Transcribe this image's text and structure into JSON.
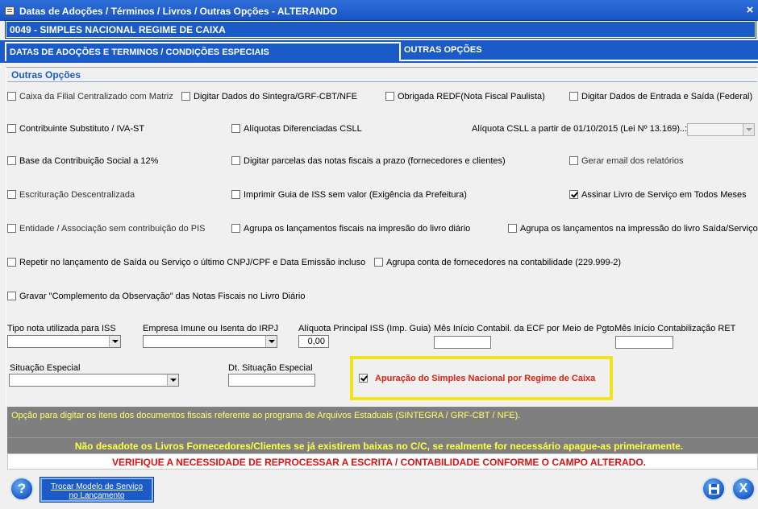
{
  "window": {
    "title": "Datas de Adoções / Términos / Livros / Outras Opções   -   ALTERANDO",
    "close": "×"
  },
  "company": "0049   -   SIMPLES NACIONAL REGIME DE CAIXA",
  "tabs": {
    "datas": "DATAS DE ADOÇÕES E TERMINOS / CONDIÇÕES ESPECIAIS",
    "outras": "OUTRAS OPÇÕES"
  },
  "section_title": "Outras Opções",
  "checkboxes": [
    {
      "label": "Caixa da Filial Centralizado com Matriz",
      "checked": false
    },
    {
      "label": "Digitar Dados do Sintegra/GRF-CBT/NFE",
      "checked": false
    },
    {
      "label": "Obrigada REDF(Nota Fiscal Paulista)",
      "checked": false
    },
    {
      "label": "Digitar Dados de Entrada e Saída (Federal)",
      "checked": false
    },
    {
      "label": "Contribuinte Substituto / IVA-ST",
      "checked": false
    },
    {
      "label": "Alíquotas Diferenciadas CSLL",
      "checked": false
    },
    {
      "label": "Base da Contribuição Social a 12%",
      "checked": false
    },
    {
      "label": "Digitar parcelas das notas fiscais a prazo (fornecedores e clientes)",
      "checked": false
    },
    {
      "label": "Gerar email dos relatórios",
      "checked": false
    },
    {
      "label": "Escrituração Descentralizada",
      "checked": false
    },
    {
      "label": "Imprimir Guia de ISS sem valor (Exigência da Prefeitura)",
      "checked": false
    },
    {
      "label": "Assinar Livro de Serviço em Todos Meses",
      "checked": true
    },
    {
      "label": "Entidade / Associação sem contribuição do PIS",
      "checked": false
    },
    {
      "label": "Agrupa os lançamentos fiscais na impresão do livro diário",
      "checked": false
    },
    {
      "label": "Agrupa os lançamentos na impressão do livro Saída/Serviço",
      "checked": false
    },
    {
      "label": "Repetir no lançamento de Saída ou Serviço o último CNPJ/CPF e Data Emissão incluso",
      "checked": false
    },
    {
      "label": "Agrupa conta de fornecedores na contabilidade (229.999-2)",
      "checked": false
    },
    {
      "label": "Gravar \"Complemento da Observação\" das Notas Fiscais no Livro Diário",
      "checked": false
    }
  ],
  "aliquota_csll": {
    "label": "Alíquota CSLL a partir de 01/10/2015 (Lei Nº 13.169)..:",
    "value": ""
  },
  "fields": {
    "tipo_nota_iss": {
      "label": "Tipo nota utilizada para ISS",
      "value": ""
    },
    "empresa_imune": {
      "label": "Empresa Imune ou Isenta do IRPJ",
      "value": ""
    },
    "aliquota_iss": {
      "label": "Alíquota Principal ISS (Imp. Guia)",
      "value": "0,00"
    },
    "mes_inicio_ecf": {
      "label": "Mês Início Contabil. da ECF por Meio de Pgto.",
      "value": ""
    },
    "mes_inicio_ret": {
      "label": "Mês Início Contabilização RET",
      "value": ""
    },
    "situacao_especial": {
      "label": "Situação Especial",
      "value": ""
    },
    "dt_situacao_especial": {
      "label": "Dt. Situação Especial",
      "value": ""
    }
  },
  "apuracao": {
    "label": "Apuração do Simples Nacional por Regime de Caixa",
    "checked": true
  },
  "info": {
    "line1": "Opção para digitar os itens dos documentos fiscais referente ao programa de Arquivos Estaduais (SINTEGRA / GRF-CBT / NFE).",
    "line2": "Não desadote os Livros Fornecedores/Clientes se já existirem baixas no C/C, se realmente for necessário apague-as primeiramente.",
    "line3": "VERIFIQUE A NECESSIDADE DE REPROCESSAR A ESCRITA / CONTABILIDADE CONFORME O CAMPO ALTERADO."
  },
  "buttons": {
    "help": "?",
    "trocar_line1": "Trocar Modelo de Serviço",
    "trocar_line2": "no Lançamento",
    "exit": "X"
  },
  "colors": {
    "accent": "#1a5bc7",
    "highlight": "#f2e41a",
    "warning_red": "#e01010",
    "info_yellow": "#ffff44"
  }
}
